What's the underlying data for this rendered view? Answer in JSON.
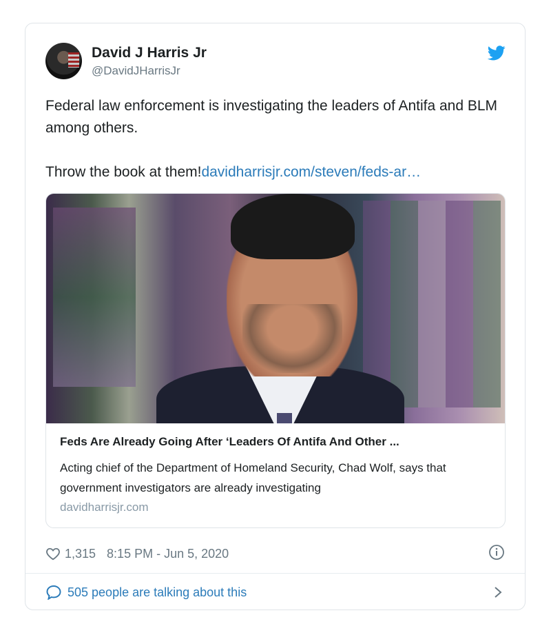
{
  "author": {
    "name": "David J Harris Jr",
    "handle": "@DavidJHarrisJr",
    "avatar_icon": "avatar-photo"
  },
  "brand_icon": "twitter-bird-icon",
  "tweet": {
    "line1": "Federal law enforcement is investigating the leaders of Antifa and BLM among others.",
    "line2_text": "Throw the book at them!",
    "line2_link": "davidharrisjr.com/steven/feds-ar…"
  },
  "link_card": {
    "title": "Feds Are Already Going After ‘Leaders Of Antifa And Other ...",
    "description": "Acting chief of the Department of Homeland Security, Chad Wolf, says that government investigators are already investigating",
    "domain": "davidharrisjr.com"
  },
  "meta": {
    "like_count": "1,315",
    "timestamp": "8:15 PM - Jun 5, 2020"
  },
  "conversation": {
    "label": "505 people are talking about this"
  },
  "colors": {
    "link": "#2b7bb9",
    "twitter_blue": "#1da1f2",
    "secondary_text": "#697882"
  }
}
